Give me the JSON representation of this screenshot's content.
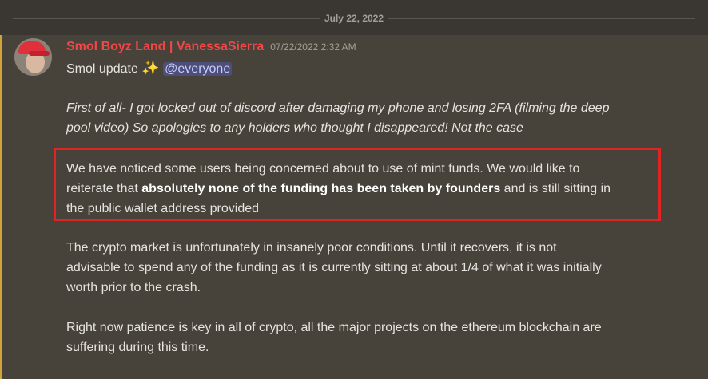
{
  "date_divider": {
    "label": "July 22, 2022"
  },
  "message": {
    "author": "Smol Boyz Land | VanessaSierra",
    "timestamp": "07/22/2022 2:32 AM",
    "line1_text": "Smol update ",
    "sparkle": "✨",
    "mention": "@everyone",
    "para1_line1": "First of all- I got locked out of discord after damaging my phone and losing 2FA (filming the deep",
    "para1_line2": "pool video) So apologies to any holders who thought I disappeared! Not the case",
    "para2_line1": "We have noticed some users being concerned about to use of mint funds. We would like to",
    "para2_line2_pre": "reiterate that ",
    "para2_line2_bold": "absolutely none of the funding has been taken by founders",
    "para2_line2_post": " and is still sitting in",
    "para2_line3": "the public wallet address provided",
    "para3_line1": "The crypto market is unfortunately in insanely poor conditions. Until it recovers, it is not",
    "para3_line2": "advisable to spend any of the funding as it is currently sitting at about 1/4 of what it was initially",
    "para3_line3": "worth prior to the crash.",
    "para4_line1": "Right now patience is key in all of crypto, all the major projects on the ethereum blockchain are",
    "para4_line2": "suffering during this time."
  },
  "colors": {
    "username": "#f04747",
    "highlight_border": "#e02424",
    "accent_bar": "#d3a33a"
  },
  "icons": {
    "sparkle": "sparkles-emoji"
  }
}
